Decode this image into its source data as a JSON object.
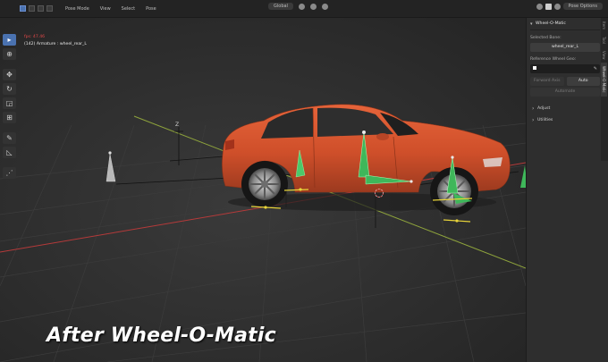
{
  "topbar": {
    "mode": "Pose Mode",
    "menus": [
      "View",
      "Select",
      "Pose"
    ],
    "transform_orientation": "Global",
    "pose_options": "Pose Options"
  },
  "viewport": {
    "fps": "fps: 47.46",
    "object_info": "(142) Armature : wheel_rear_L",
    "axis_label": "Z",
    "caption": "After Wheel-O-Matic"
  },
  "tools": [
    "select-tool",
    "cursor-tool",
    "move-tool",
    "rotate-tool",
    "scale-tool",
    "transform-tool",
    "annotate-tool",
    "measure-tool",
    "relax-tool"
  ],
  "colors": {
    "car_body": "#d9552f",
    "bone_green": "#3fb75a",
    "x_axis": "#b53a3a",
    "y_axis": "#8ea33c",
    "accent": "#4a72b0"
  },
  "npanel": {
    "header": "Wheel-O-Matic",
    "selected_bone_label": "Selected Bone:",
    "selected_bone_value": "wheel_rear_L",
    "reference_geo_label": "Reference Wheel Geo:",
    "reference_geo_value": "",
    "forward_axis_label": "Forward Axis",
    "auto_label": "Auto",
    "automate_label": "Automate",
    "sections": [
      "Adjust",
      "Utilities"
    ],
    "tabs": [
      "Item",
      "Tool",
      "View",
      "Wheel-O-Matic"
    ]
  }
}
